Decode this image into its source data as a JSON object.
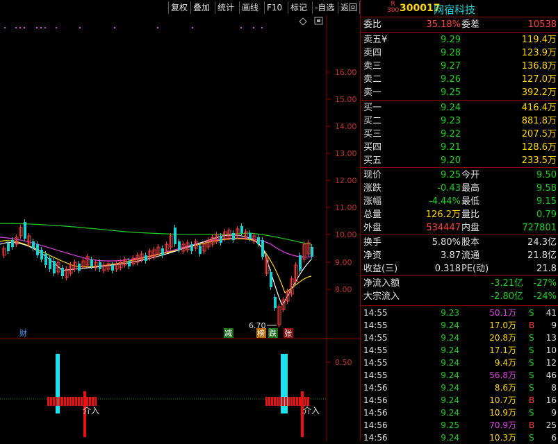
{
  "menu": [
    "复权",
    "叠加",
    "统计",
    "画线",
    "F10",
    "标记",
    "-自选",
    "返回"
  ],
  "stock": {
    "badge_top": "R",
    "badge_bottom": "300",
    "code": "300017",
    "name": "网宿科技"
  },
  "weibi": {
    "label1": "委比",
    "val1": "35.18%",
    "label2": "委差",
    "val2": "10538"
  },
  "asks": [
    {
      "label": "卖五¥",
      "price": "9.29",
      "vol": "119.4万"
    },
    {
      "label": "卖四",
      "price": "9.28",
      "vol": "123.9万"
    },
    {
      "label": "卖三",
      "price": "9.27",
      "vol": "136.8万"
    },
    {
      "label": "卖二",
      "price": "9.26",
      "vol": "127.0万"
    },
    {
      "label": "卖一",
      "price": "9.25",
      "vol": "392.2万"
    }
  ],
  "bids": [
    {
      "label": "买一",
      "price": "9.24",
      "vol": "416.4万"
    },
    {
      "label": "买二",
      "price": "9.23",
      "vol": "881.8万"
    },
    {
      "label": "买三",
      "price": "9.22",
      "vol": "207.5万"
    },
    {
      "label": "买四",
      "price": "9.21",
      "vol": "128.6万"
    },
    {
      "label": "买五",
      "price": "9.20",
      "vol": "233.5万"
    }
  ],
  "quote": [
    {
      "l1": "现价",
      "v1": "9.25",
      "c1": "g",
      "l2": "今开",
      "v2": "9.50",
      "c2": "g"
    },
    {
      "l1": "涨跌",
      "v1": "-0.43",
      "c1": "g",
      "l2": "最高",
      "v2": "9.58",
      "c2": "g"
    },
    {
      "l1": "涨幅",
      "v1": "-4.44%",
      "c1": "g",
      "l2": "最低",
      "v2": "9.15",
      "c2": "g"
    },
    {
      "l1": "总量",
      "v1": "126.2万",
      "c1": "y",
      "l2": "量比",
      "v2": "0.79",
      "c2": "g"
    },
    {
      "l1": "外盘",
      "v1": "534447",
      "c1": "r",
      "l2": "内盘",
      "v2": "727801",
      "c2": "g"
    }
  ],
  "fund": [
    {
      "l1": "换手",
      "v1": "5.80%",
      "l2": "股本",
      "v2": "24.3亿"
    },
    {
      "l1": "净资",
      "v1": "3.87",
      "l2": "流通",
      "v2": "21.8亿"
    },
    {
      "l1": "收益(三)",
      "v1": "0.318",
      "l2": "PE(动)",
      "v2": "21.8"
    }
  ],
  "flows": [
    {
      "label": "净流入额",
      "v1": "-3.21亿",
      "v2": "-27%"
    },
    {
      "label": "大宗流入",
      "v1": "-2.80亿",
      "v2": "-24%"
    }
  ],
  "ticks": [
    {
      "time": "14:55",
      "price": "9.23",
      "vol": "50.1万",
      "vc": "m",
      "flag": "S",
      "cnt": "41"
    },
    {
      "time": "14:55",
      "price": "9.24",
      "vol": "17.0万",
      "vc": "y",
      "flag": "B",
      "cnt": "9"
    },
    {
      "time": "14:55",
      "price": "9.24",
      "vol": "20.8万",
      "vc": "y",
      "flag": "S",
      "cnt": "13"
    },
    {
      "time": "14:55",
      "price": "9.24",
      "vol": "17.1万",
      "vc": "y",
      "flag": "S",
      "cnt": "10"
    },
    {
      "time": "14:55",
      "price": "9.24",
      "vol": "9.4万",
      "vc": "y",
      "flag": "S",
      "cnt": "12"
    },
    {
      "time": "14:55",
      "price": "9.24",
      "vol": "56.8万",
      "vc": "m",
      "flag": "S",
      "cnt": "46"
    },
    {
      "time": "14:56",
      "price": "9.24",
      "vol": "8.6万",
      "vc": "y",
      "flag": "S",
      "cnt": "8"
    },
    {
      "time": "14:56",
      "price": "9.24",
      "vol": "10.7万",
      "vc": "y",
      "flag": "B",
      "cnt": "16"
    },
    {
      "time": "14:56",
      "price": "9.24",
      "vol": "10.9万",
      "vc": "y",
      "flag": "S",
      "cnt": "9"
    },
    {
      "time": "14:56",
      "price": "9.25",
      "vol": "70.9万",
      "vc": "m",
      "flag": "B",
      "cnt": "25"
    },
    {
      "time": "14:56",
      "price": "9.24",
      "vol": "10.3万",
      "vc": "y",
      "flag": "S",
      "cnt": "6"
    }
  ],
  "axis": {
    "price_ticks": [
      "16.00",
      "15.00",
      "14.00",
      "13.00",
      "12.00",
      "11.00",
      "10.00",
      "9.00",
      "8.00"
    ],
    "ind_tick": "0.50"
  },
  "annotations": {
    "low_label": "6.70",
    "cai": "财",
    "jian": "减",
    "bang": "榜",
    "die": "跌",
    "zhang": "张",
    "jieru1": "介入",
    "jieru2": "介入"
  },
  "colors": {
    "up": "#ff4040",
    "down": "#20d0d0",
    "ma5": "#ffffff",
    "ma10": "#ffd700",
    "ma20": "#e040e0",
    "ma60": "#20d020",
    "divider": "#8b0000"
  }
}
